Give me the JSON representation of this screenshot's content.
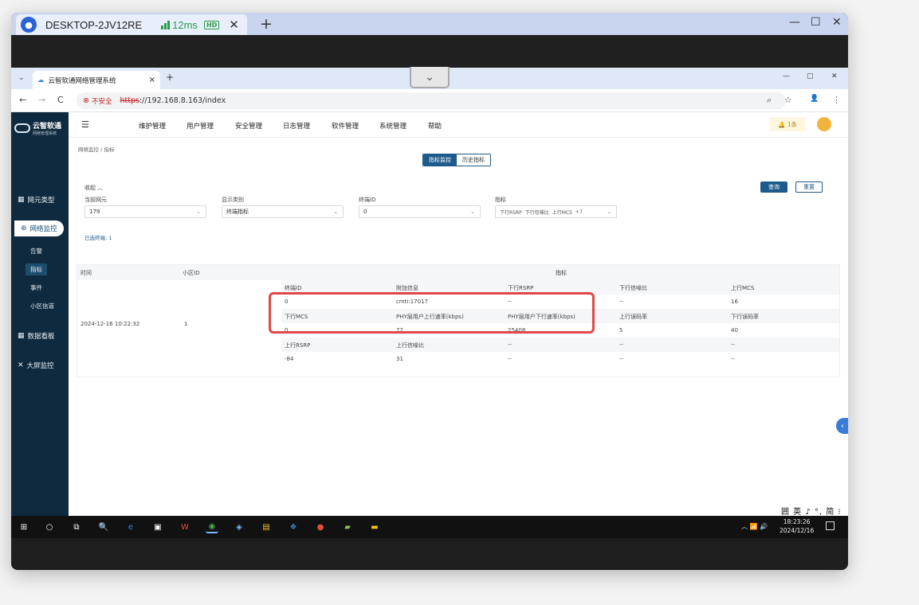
{
  "remote_bar": {
    "host": "DESKTOP-2JV12RE",
    "latency": "12ms",
    "quality_badge": "HD",
    "close_symbol": "✕",
    "add_symbol": "+",
    "controls": [
      "—",
      "☐",
      "✕"
    ],
    "avatar_icon": "user-icon"
  },
  "collapse_chevron": "⌄",
  "browser": {
    "tab_title": "云智软通网络管理系统",
    "tab_close": "×",
    "new_tab": "+",
    "window_controls": [
      "—",
      "▢",
      "✕"
    ],
    "nav": [
      "←",
      "→",
      "C"
    ],
    "security_label": "不安全",
    "url_scheme": "https",
    "url_rest": "://192.168.8.163/index",
    "icons": [
      "⌕",
      "☆",
      "👤",
      "⋮"
    ]
  },
  "app": {
    "logo_title": "云智软通",
    "logo_sub": "网络管理系统",
    "sidebar": {
      "items": [
        {
          "icon": "▦",
          "label": "网元类型"
        },
        {
          "icon": "⊛",
          "label": "网络监控"
        },
        {
          "icon": "▦",
          "label": "数据看板"
        },
        {
          "icon": "✕",
          "label": "大屏监控"
        }
      ],
      "sub_items": [
        "告警",
        "指标",
        "事件",
        "小区信道"
      ]
    },
    "menu_icon": "☰",
    "topnav": [
      "维护管理",
      "用户管理",
      "安全管理",
      "日志管理",
      "软件管理",
      "系统管理",
      "帮助"
    ],
    "bell": "🔔 1条",
    "breadcrumb": "网络监控  /  指标",
    "segment": {
      "active": "指标监控",
      "inactive": "历史指标"
    },
    "collapse_label": "收起  ︿",
    "query_button": "查询",
    "reset_button": "重置",
    "filters": [
      {
        "label": "当前网元",
        "value": "179"
      },
      {
        "label": "显示类别",
        "value": "终端指标"
      },
      {
        "label": "终端ID",
        "value": "0"
      },
      {
        "label": "指标",
        "tags": [
          "下行RSRP",
          "下行信噪比",
          "上行MCS",
          "+7"
        ]
      }
    ],
    "dropdown_caret": "⌄",
    "selected_count": "已选终端: 1",
    "table": {
      "headers": [
        "时间",
        "小区ID",
        "指标"
      ],
      "time": "2024-12-16 10:22:32",
      "cell_id": "1",
      "rows": [
        {
          "type": "head",
          "cols": [
            "终端ID",
            "附加信息",
            "下行RSRP",
            "下行信噪比",
            "上行MCS"
          ]
        },
        {
          "type": "data",
          "cols": [
            "0",
            "cmti:17017",
            "--",
            "--",
            "16"
          ]
        },
        {
          "type": "head",
          "cols": [
            "下行MCS",
            "PHY层用户上行速率(kbps)",
            "PHY层用户下行速率(kbps)",
            "上行误码率",
            "下行误码率"
          ]
        },
        {
          "type": "data",
          "cols": [
            "0",
            "72",
            "25408",
            "5",
            "40"
          ]
        },
        {
          "type": "head",
          "cols": [
            "上行RSRP",
            "上行信噪比",
            "--",
            "--",
            "--"
          ]
        },
        {
          "type": "data",
          "cols": [
            "-84",
            "31",
            "--",
            "--",
            "--"
          ]
        }
      ]
    },
    "side_toggle": "‹",
    "ime_bar": "囲 英 ♪ °, 简 ⁝"
  },
  "taskbar": {
    "icons": [
      "⊞",
      "○",
      "⧉",
      "🔍",
      "e",
      "▣",
      "W",
      "◉",
      "◈",
      "▤",
      "❖",
      "●",
      "▰",
      "▬"
    ],
    "tray": "︿  📶  🔊",
    "time": "18:23:26",
    "date": "2024/12/16"
  }
}
